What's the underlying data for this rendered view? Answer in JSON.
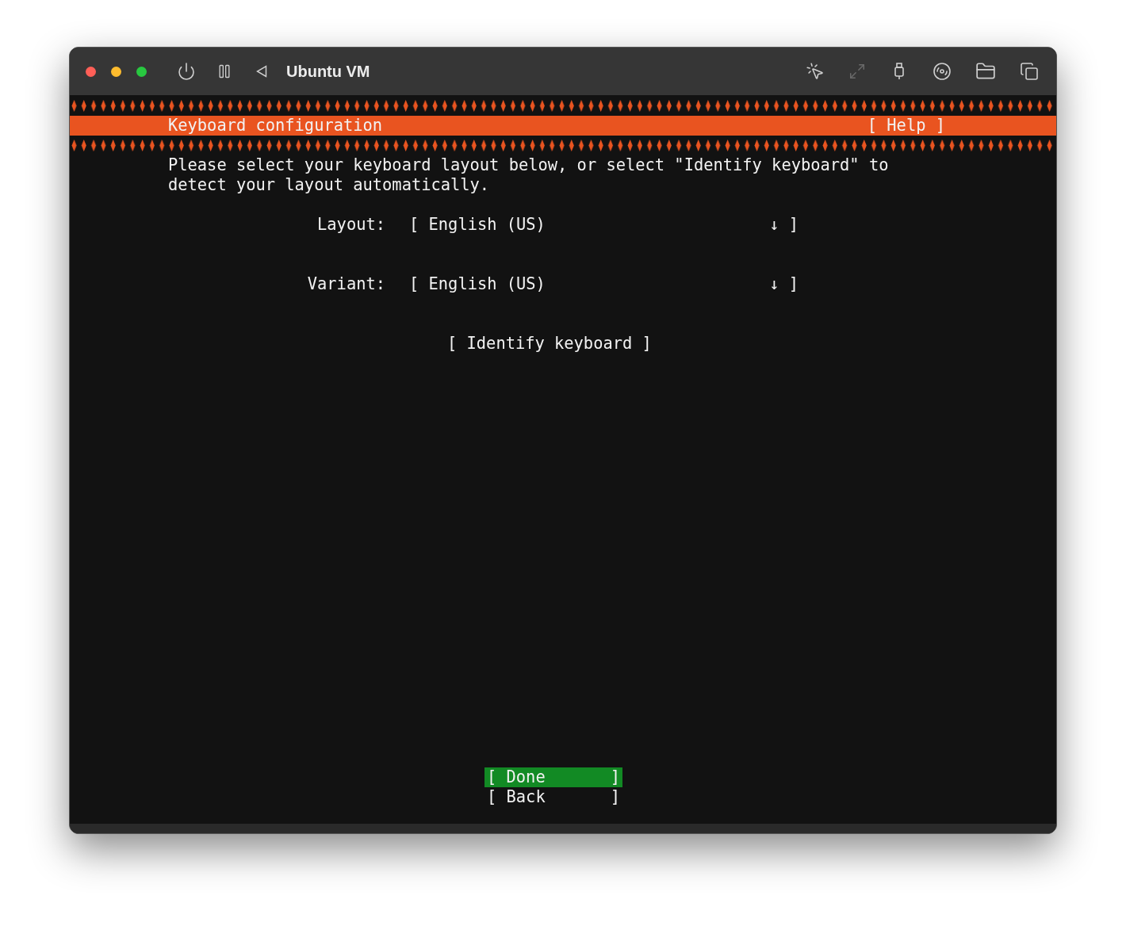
{
  "window": {
    "title": "Ubuntu VM"
  },
  "toolbar_left": [
    {
      "kind": "power",
      "disabled": false
    },
    {
      "kind": "pause",
      "disabled": false
    },
    {
      "kind": "back",
      "disabled": false
    }
  ],
  "toolbar_right": [
    {
      "kind": "capture",
      "disabled": false
    },
    {
      "kind": "resize",
      "disabled": true
    },
    {
      "kind": "usb",
      "disabled": false
    },
    {
      "kind": "disc",
      "disabled": false
    },
    {
      "kind": "shared-folder",
      "disabled": false
    },
    {
      "kind": "windows",
      "disabled": false
    }
  ],
  "header": {
    "title": "Keyboard configuration",
    "help": "[ Help ]"
  },
  "instructions": [
    "Please select your keyboard layout below, or select \"Identify keyboard\" to",
    "detect your layout automatically."
  ],
  "fields": [
    {
      "label": "Layout:",
      "value": "[ English (US)",
      "end": "↓ ]"
    },
    {
      "label": "Variant:",
      "value": "[ English (US)",
      "end": "↓ ]"
    }
  ],
  "identify_button": "[ Identify keyboard ]",
  "buttons": [
    {
      "label": "[ Done",
      "end": "]",
      "selected": true
    },
    {
      "label": "[ Back",
      "end": "]",
      "selected": false
    }
  ]
}
